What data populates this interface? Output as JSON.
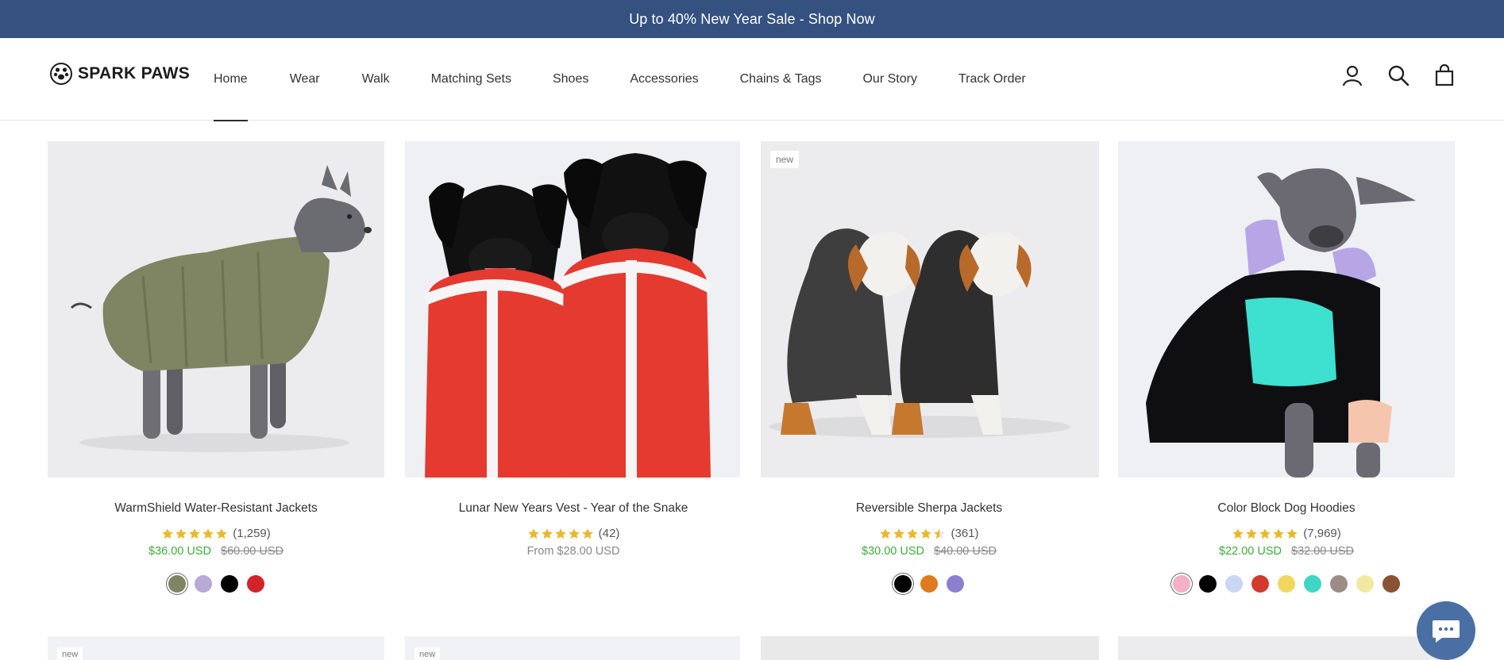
{
  "announcement": "Up to 40% New Year Sale - Shop Now",
  "brand": {
    "name": "SPARK PAWS"
  },
  "nav": [
    {
      "label": "Home",
      "active": true
    },
    {
      "label": "Wear"
    },
    {
      "label": "Walk"
    },
    {
      "label": "Matching Sets"
    },
    {
      "label": "Shoes"
    },
    {
      "label": "Accessories"
    },
    {
      "label": "Chains & Tags"
    },
    {
      "label": "Our Story"
    },
    {
      "label": "Track Order"
    }
  ],
  "header_icons": [
    "account-icon",
    "search-icon",
    "cart-icon"
  ],
  "products": [
    {
      "title": "WarmShield Water-Resistant Jackets",
      "rating": 5,
      "reviews": "(1,259)",
      "price": "$36.00 USD",
      "compare_price": "$60.00 USD",
      "swatches": [
        "#7f8563",
        "#b9a9d6",
        "#000000",
        "#d1232a"
      ]
    },
    {
      "title": "Lunar New Years Vest - Year of the Snake",
      "rating": 5,
      "reviews": "(42)",
      "price": "From $28.00 USD"
    },
    {
      "title": "Reversible Sherpa Jackets",
      "badge": "new",
      "rating": 4.5,
      "reviews": "(361)",
      "price": "$30.00 USD",
      "compare_price": "$40.00 USD",
      "swatches": [
        "#000000",
        "#e07a1f",
        "#8c7fd0"
      ]
    },
    {
      "title": "Color Block Dog Hoodies",
      "rating": 5,
      "reviews": "(7,969)",
      "price": "$22.00 USD",
      "compare_price": "$32.00 USD",
      "swatches": [
        "#f4b0c4",
        "#000000",
        "#c9d6f5",
        "#d13b2e",
        "#f2d75e",
        "#3fd6c6",
        "#9b8d86",
        "#f2e9a0",
        "#8a5132"
      ]
    }
  ],
  "row2_badges": [
    "new",
    "new"
  ],
  "colors": {
    "announcement_bg": "#34517f",
    "sale": "#3cad3a",
    "star": "#e8b92d"
  }
}
